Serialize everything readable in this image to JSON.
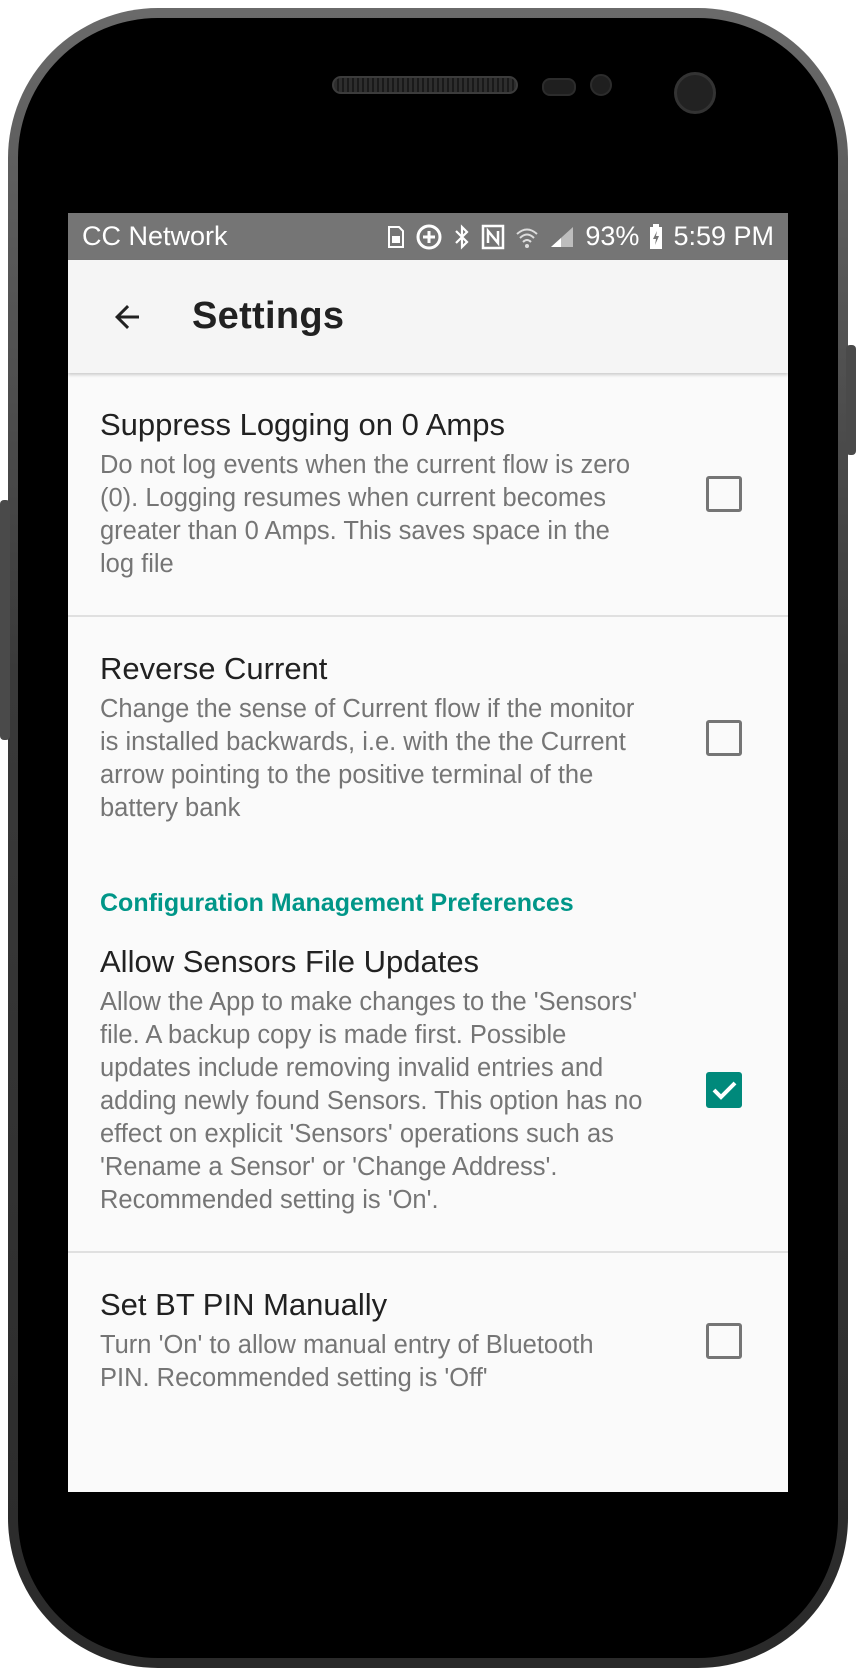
{
  "status_bar": {
    "carrier": "CC Network",
    "battery_percent": "93%",
    "time": "5:59 PM"
  },
  "app_bar": {
    "title": "Settings"
  },
  "preferences": [
    {
      "title": "Suppress Logging on 0 Amps",
      "summary": "Do not log events when the current flow is zero (0). Logging resumes when current becomes greater than 0 Amps. This saves space in the log file",
      "checked": false
    },
    {
      "title": "Reverse Current",
      "summary": "Change the sense of Current flow if the monitor is installed backwards, i.e. with the the Current arrow pointing to the positive terminal of the battery bank",
      "checked": false
    }
  ],
  "category": {
    "label": "Configuration Management Preferences"
  },
  "config_preferences": [
    {
      "title": "Allow Sensors File Updates",
      "summary": "Allow the App to make changes to the 'Sensors' file. A backup copy is made first. Possible updates include removing invalid entries and adding newly found Sensors. This option has no effect on explicit 'Sensors' operations such as 'Rename a Sensor' or 'Change Address'. Recommended setting is 'On'.",
      "checked": true
    },
    {
      "title": "Set BT PIN Manually",
      "summary": "Turn 'On' to allow manual entry of Bluetooth PIN. Recommended setting is 'Off'",
      "checked": false
    }
  ],
  "colors": {
    "accent": "#009688",
    "checkbox_checked": "#00897b",
    "status_bar": "#757575",
    "app_bar": "#f5f5f5"
  }
}
